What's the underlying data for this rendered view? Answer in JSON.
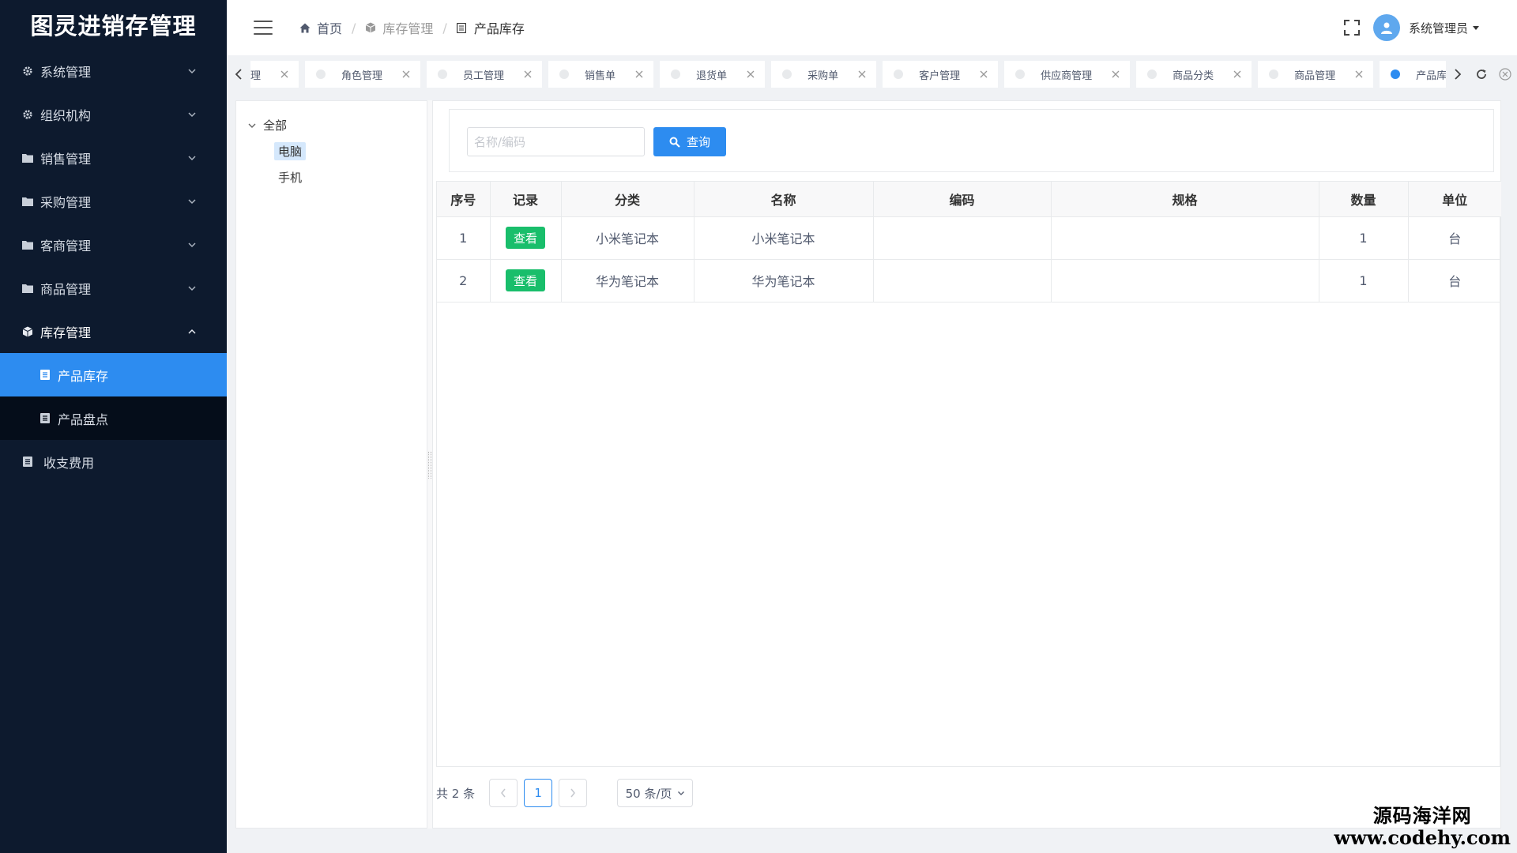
{
  "app": {
    "title": "图灵进销存管理"
  },
  "sidebar": {
    "menus": [
      {
        "label": "系统管理",
        "icon": "gear-icon"
      },
      {
        "label": "组织机构",
        "icon": "gear-icon"
      },
      {
        "label": "销售管理",
        "icon": "folder-icon"
      },
      {
        "label": "采购管理",
        "icon": "folder-icon"
      },
      {
        "label": "客商管理",
        "icon": "folder-icon"
      },
      {
        "label": "商品管理",
        "icon": "folder-icon"
      },
      {
        "label": "库存管理",
        "icon": "cube-icon",
        "expanded": true
      }
    ],
    "submenu": [
      {
        "label": "产品库存",
        "active": true
      },
      {
        "label": "产品盘点",
        "active": false
      }
    ],
    "last": {
      "label": "收支费用"
    }
  },
  "header": {
    "breadcrumb": [
      {
        "label": "首页"
      },
      {
        "label": "库存管理"
      },
      {
        "label": "产品库存"
      }
    ],
    "user": {
      "name": "系统管理员"
    }
  },
  "tabs": [
    {
      "label": "理",
      "active": false
    },
    {
      "label": "角色管理",
      "active": false
    },
    {
      "label": "员工管理",
      "active": false
    },
    {
      "label": "销售单",
      "active": false
    },
    {
      "label": "退货单",
      "active": false
    },
    {
      "label": "采购单",
      "active": false
    },
    {
      "label": "客户管理",
      "active": false
    },
    {
      "label": "供应商管理",
      "active": false
    },
    {
      "label": "商品分类",
      "active": false
    },
    {
      "label": "商品管理",
      "active": false
    },
    {
      "label": "产品库存",
      "active": true
    }
  ],
  "tree": {
    "root": "全部",
    "children": [
      {
        "label": "电脑",
        "selected": true
      },
      {
        "label": "手机",
        "selected": false
      }
    ]
  },
  "search": {
    "placeholder": "名称/编码",
    "value": "",
    "button": "查询"
  },
  "table": {
    "columns": [
      "序号",
      "记录",
      "分类",
      "名称",
      "编码",
      "规格",
      "数量",
      "单位"
    ],
    "rows": [
      {
        "index": "1",
        "action": "查看",
        "category": "小米笔记本",
        "name": "小米笔记本",
        "code": "",
        "spec": "",
        "qty": "1",
        "unit": "台"
      },
      {
        "index": "2",
        "action": "查看",
        "category": "华为笔记本",
        "name": "华为笔记本",
        "code": "",
        "spec": "",
        "qty": "1",
        "unit": "台"
      }
    ]
  },
  "pagination": {
    "total": "共 2 条",
    "current": "1",
    "page_size": "50 条/页"
  },
  "watermark": {
    "line1": "源码海洋网",
    "line2": "www.codehy.com"
  },
  "colors": {
    "sidebar_bg": "#0d1a2e",
    "accent": "#2d8cf0",
    "success": "#19be6b"
  }
}
